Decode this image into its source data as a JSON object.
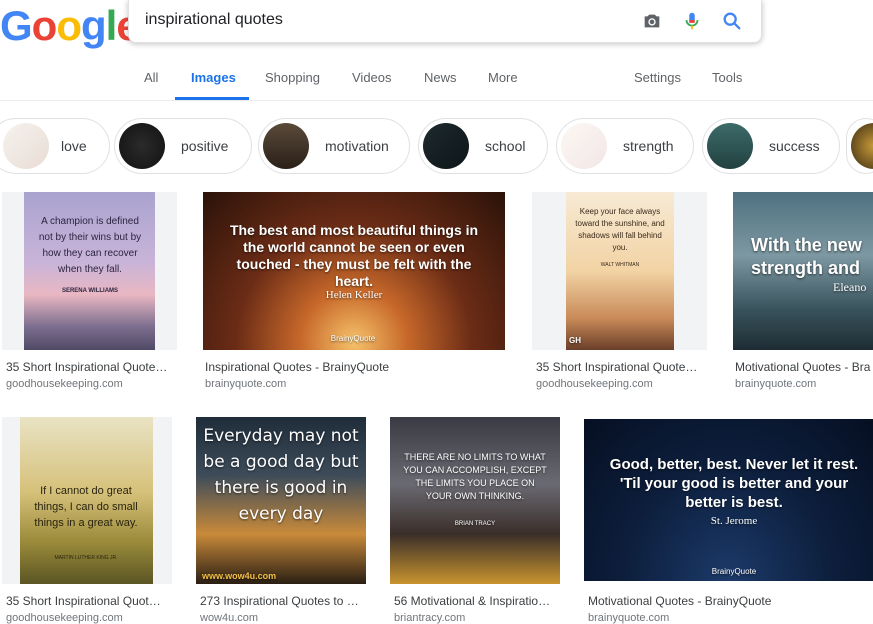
{
  "logo": [
    "G",
    "o",
    "o",
    "g",
    "l",
    "e"
  ],
  "search": {
    "query": "inspirational quotes"
  },
  "tabs": {
    "all": "All",
    "images": "Images",
    "shopping": "Shopping",
    "videos": "Videos",
    "news": "News",
    "more": "More",
    "settings": "Settings",
    "tools": "Tools"
  },
  "chips": [
    {
      "label": "love"
    },
    {
      "label": "positive"
    },
    {
      "label": "motivation"
    },
    {
      "label": "school"
    },
    {
      "label": "strength"
    },
    {
      "label": "success"
    }
  ],
  "row1": [
    {
      "title": "35 Short Inspirational Quote…",
      "source": "goodhousekeeping.com",
      "quote": "A champion is defined not by their wins but by how they can recover when they fall.",
      "author": "SERENA WILLIAMS"
    },
    {
      "title": "Inspirational Quotes - BrainyQuote",
      "source": "brainyquote.com",
      "quote": "The best and most beautiful things in the world cannot be seen or even touched - they must be felt with the heart.",
      "author": "Helen Keller",
      "brand": "BrainyQuote"
    },
    {
      "title": "35 Short Inspirational Quote…",
      "source": "goodhousekeeping.com",
      "quote": "Keep your face always toward the sunshine, and shadows will fall behind you.",
      "author": "WALT WHITMAN",
      "badge": "GH"
    },
    {
      "title": "Motivational Quotes - Bra",
      "source": "brainyquote.com",
      "quote": "With the new strength and",
      "author": "Eleano"
    }
  ],
  "row2": [
    {
      "title": "35 Short Inspirational Quot…",
      "source": "goodhousekeeping.com",
      "quote": "If I cannot do great things, I can do small things in a great way.",
      "author": "MARTIN LUTHER KING JR."
    },
    {
      "title": "273 Inspirational Quotes to …",
      "source": "wow4u.com",
      "quote": "Everyday may not be a good day but there is good in every day",
      "brand": "www.wow4u.com"
    },
    {
      "title": "56 Motivational & Inspiratio…",
      "source": "briantracy.com",
      "quote": "THERE ARE NO LIMITS TO WHAT YOU CAN ACCOMPLISH, EXCEPT THE LIMITS YOU PLACE ON YOUR OWN THINKING.",
      "author": "BRIAN TRACY"
    },
    {
      "title": "Motivational Quotes - BrainyQuote",
      "source": "brainyquote.com",
      "quote": "Good, better, best. Never let it rest. 'Til your good is better and your better is best.",
      "author": "St. Jerome",
      "brand": "BrainyQuote"
    }
  ]
}
